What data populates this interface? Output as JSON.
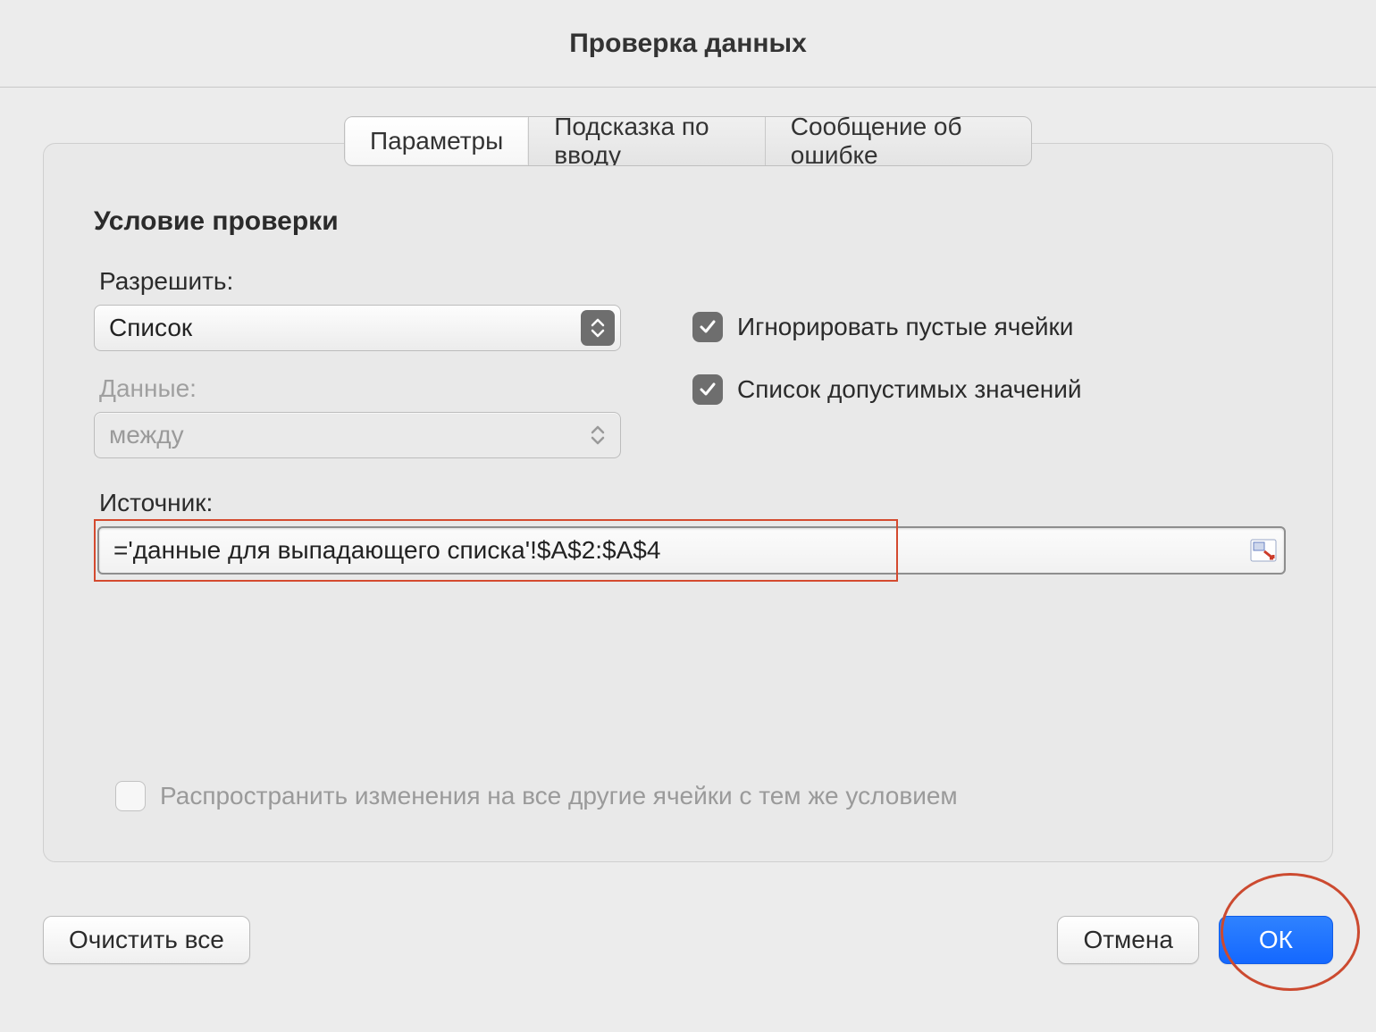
{
  "title": "Проверка данных",
  "tabs": {
    "parameters": "Параметры",
    "input_hint": "Подсказка по вводу",
    "error_msg": "Сообщение об ошибке"
  },
  "section_heading": "Условие проверки",
  "labels": {
    "allow": "Разрешить:",
    "data": "Данные:",
    "source": "Источник:"
  },
  "allow_value": "Список",
  "data_value": "между",
  "checkboxes": {
    "ignore_blank": "Игнорировать пустые ячейки",
    "in_cell_dropdown": "Список допустимых значений",
    "apply_same": "Распространить изменения на все другие ячейки с тем же условием"
  },
  "source_value": "='данные для выпадающего списка'!$A$2:$A$4",
  "buttons": {
    "clear_all": "Очистить все",
    "cancel": "Отмена",
    "ok": "ОК"
  }
}
